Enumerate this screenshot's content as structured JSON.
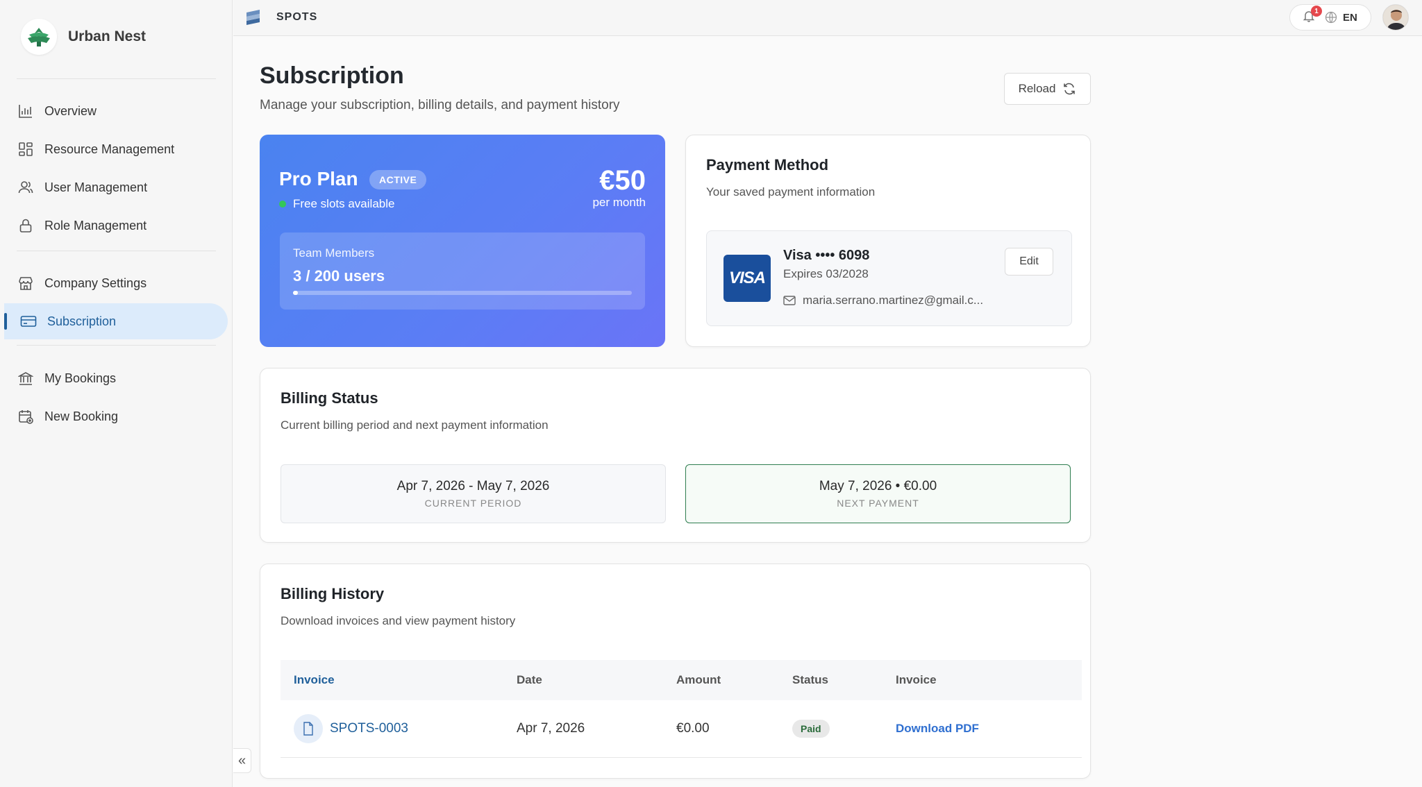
{
  "brand": {
    "name": "Urban Nest"
  },
  "sidebar": {
    "items": [
      {
        "label": "Overview",
        "icon": "bar-chart-icon"
      },
      {
        "label": "Resource Management",
        "icon": "grid-icon"
      },
      {
        "label": "User Management",
        "icon": "users-icon"
      },
      {
        "label": "Role Management",
        "icon": "lock-icon"
      },
      {
        "label": "Company Settings",
        "icon": "store-icon"
      },
      {
        "label": "Subscription",
        "icon": "credit-card-icon",
        "active": true
      },
      {
        "label": "My Bookings",
        "icon": "bank-icon"
      },
      {
        "label": "New Booking",
        "icon": "calendar-plus-icon"
      }
    ],
    "collapse_label": "«"
  },
  "topbar": {
    "title": "SPOTS",
    "notification_count": "1",
    "language": "EN"
  },
  "page": {
    "title": "Subscription",
    "subtitle": "Manage your subscription, billing details, and payment history",
    "reload_label": "Reload"
  },
  "plan": {
    "name": "Pro Plan",
    "badge": "ACTIVE",
    "slots_text": "Free slots available",
    "price": "€50",
    "period": "per month",
    "team_label": "Team Members",
    "team_value": "3 / 200 users",
    "team_used_fraction": 0.015
  },
  "payment": {
    "title": "Payment Method",
    "subtitle": "Your saved payment information",
    "brand_logo_text": "VISA",
    "card_number": "Visa •••• 6098",
    "expires": "Expires 03/2028",
    "email": "maria.serrano.martinez@gmail.c...",
    "edit_label": "Edit"
  },
  "billing_status": {
    "title": "Billing Status",
    "subtitle": "Current billing period and next payment information",
    "current_period": "Apr 7, 2026 - May 7, 2026",
    "current_period_caption": "CURRENT PERIOD",
    "next_payment": "May 7, 2026 • €0.00",
    "next_payment_caption": "NEXT PAYMENT"
  },
  "billing_history": {
    "title": "Billing History",
    "subtitle": "Download invoices and view payment history",
    "columns": [
      "Invoice",
      "Date",
      "Amount",
      "Status",
      "Invoice"
    ],
    "rows": [
      {
        "invoice": "SPOTS-0003",
        "date": "Apr 7, 2026",
        "amount": "€0.00",
        "status": "Paid",
        "action": "Download PDF"
      }
    ]
  },
  "colors": {
    "accent": "#1f5f9a",
    "plan_gradient_start": "#4a83f0",
    "plan_gradient_end": "#6a74f7",
    "next_payment_border": "#2e7d4f",
    "link": "#2f6fd0"
  }
}
